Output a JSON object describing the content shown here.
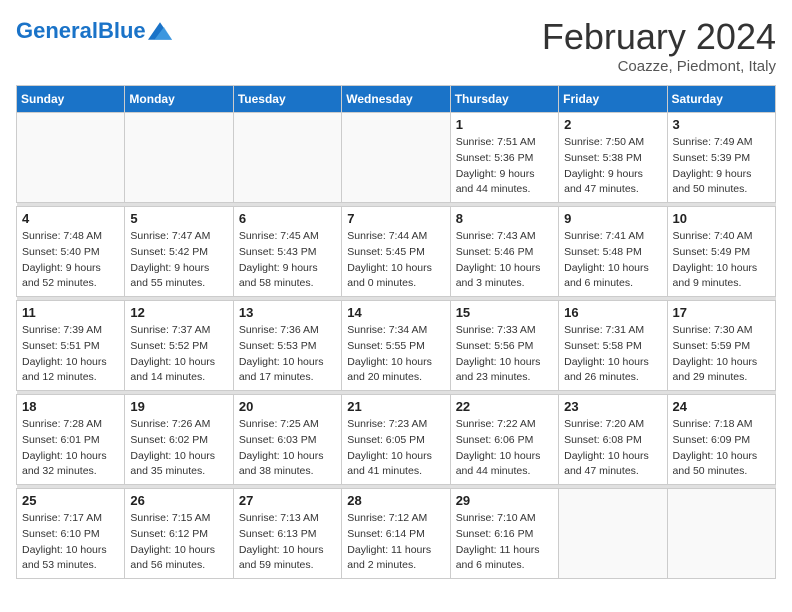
{
  "header": {
    "logo_general": "General",
    "logo_blue": "Blue",
    "month_title": "February 2024",
    "subtitle": "Coazze, Piedmont, Italy"
  },
  "calendar": {
    "days_of_week": [
      "Sunday",
      "Monday",
      "Tuesday",
      "Wednesday",
      "Thursday",
      "Friday",
      "Saturday"
    ],
    "weeks": [
      [
        {
          "day": "",
          "info": ""
        },
        {
          "day": "",
          "info": ""
        },
        {
          "day": "",
          "info": ""
        },
        {
          "day": "",
          "info": ""
        },
        {
          "day": "1",
          "info": "Sunrise: 7:51 AM\nSunset: 5:36 PM\nDaylight: 9 hours\nand 44 minutes."
        },
        {
          "day": "2",
          "info": "Sunrise: 7:50 AM\nSunset: 5:38 PM\nDaylight: 9 hours\nand 47 minutes."
        },
        {
          "day": "3",
          "info": "Sunrise: 7:49 AM\nSunset: 5:39 PM\nDaylight: 9 hours\nand 50 minutes."
        }
      ],
      [
        {
          "day": "4",
          "info": "Sunrise: 7:48 AM\nSunset: 5:40 PM\nDaylight: 9 hours\nand 52 minutes."
        },
        {
          "day": "5",
          "info": "Sunrise: 7:47 AM\nSunset: 5:42 PM\nDaylight: 9 hours\nand 55 minutes."
        },
        {
          "day": "6",
          "info": "Sunrise: 7:45 AM\nSunset: 5:43 PM\nDaylight: 9 hours\nand 58 minutes."
        },
        {
          "day": "7",
          "info": "Sunrise: 7:44 AM\nSunset: 5:45 PM\nDaylight: 10 hours\nand 0 minutes."
        },
        {
          "day": "8",
          "info": "Sunrise: 7:43 AM\nSunset: 5:46 PM\nDaylight: 10 hours\nand 3 minutes."
        },
        {
          "day": "9",
          "info": "Sunrise: 7:41 AM\nSunset: 5:48 PM\nDaylight: 10 hours\nand 6 minutes."
        },
        {
          "day": "10",
          "info": "Sunrise: 7:40 AM\nSunset: 5:49 PM\nDaylight: 10 hours\nand 9 minutes."
        }
      ],
      [
        {
          "day": "11",
          "info": "Sunrise: 7:39 AM\nSunset: 5:51 PM\nDaylight: 10 hours\nand 12 minutes."
        },
        {
          "day": "12",
          "info": "Sunrise: 7:37 AM\nSunset: 5:52 PM\nDaylight: 10 hours\nand 14 minutes."
        },
        {
          "day": "13",
          "info": "Sunrise: 7:36 AM\nSunset: 5:53 PM\nDaylight: 10 hours\nand 17 minutes."
        },
        {
          "day": "14",
          "info": "Sunrise: 7:34 AM\nSunset: 5:55 PM\nDaylight: 10 hours\nand 20 minutes."
        },
        {
          "day": "15",
          "info": "Sunrise: 7:33 AM\nSunset: 5:56 PM\nDaylight: 10 hours\nand 23 minutes."
        },
        {
          "day": "16",
          "info": "Sunrise: 7:31 AM\nSunset: 5:58 PM\nDaylight: 10 hours\nand 26 minutes."
        },
        {
          "day": "17",
          "info": "Sunrise: 7:30 AM\nSunset: 5:59 PM\nDaylight: 10 hours\nand 29 minutes."
        }
      ],
      [
        {
          "day": "18",
          "info": "Sunrise: 7:28 AM\nSunset: 6:01 PM\nDaylight: 10 hours\nand 32 minutes."
        },
        {
          "day": "19",
          "info": "Sunrise: 7:26 AM\nSunset: 6:02 PM\nDaylight: 10 hours\nand 35 minutes."
        },
        {
          "day": "20",
          "info": "Sunrise: 7:25 AM\nSunset: 6:03 PM\nDaylight: 10 hours\nand 38 minutes."
        },
        {
          "day": "21",
          "info": "Sunrise: 7:23 AM\nSunset: 6:05 PM\nDaylight: 10 hours\nand 41 minutes."
        },
        {
          "day": "22",
          "info": "Sunrise: 7:22 AM\nSunset: 6:06 PM\nDaylight: 10 hours\nand 44 minutes."
        },
        {
          "day": "23",
          "info": "Sunrise: 7:20 AM\nSunset: 6:08 PM\nDaylight: 10 hours\nand 47 minutes."
        },
        {
          "day": "24",
          "info": "Sunrise: 7:18 AM\nSunset: 6:09 PM\nDaylight: 10 hours\nand 50 minutes."
        }
      ],
      [
        {
          "day": "25",
          "info": "Sunrise: 7:17 AM\nSunset: 6:10 PM\nDaylight: 10 hours\nand 53 minutes."
        },
        {
          "day": "26",
          "info": "Sunrise: 7:15 AM\nSunset: 6:12 PM\nDaylight: 10 hours\nand 56 minutes."
        },
        {
          "day": "27",
          "info": "Sunrise: 7:13 AM\nSunset: 6:13 PM\nDaylight: 10 hours\nand 59 minutes."
        },
        {
          "day": "28",
          "info": "Sunrise: 7:12 AM\nSunset: 6:14 PM\nDaylight: 11 hours\nand 2 minutes."
        },
        {
          "day": "29",
          "info": "Sunrise: 7:10 AM\nSunset: 6:16 PM\nDaylight: 11 hours\nand 6 minutes."
        },
        {
          "day": "",
          "info": ""
        },
        {
          "day": "",
          "info": ""
        }
      ]
    ]
  }
}
